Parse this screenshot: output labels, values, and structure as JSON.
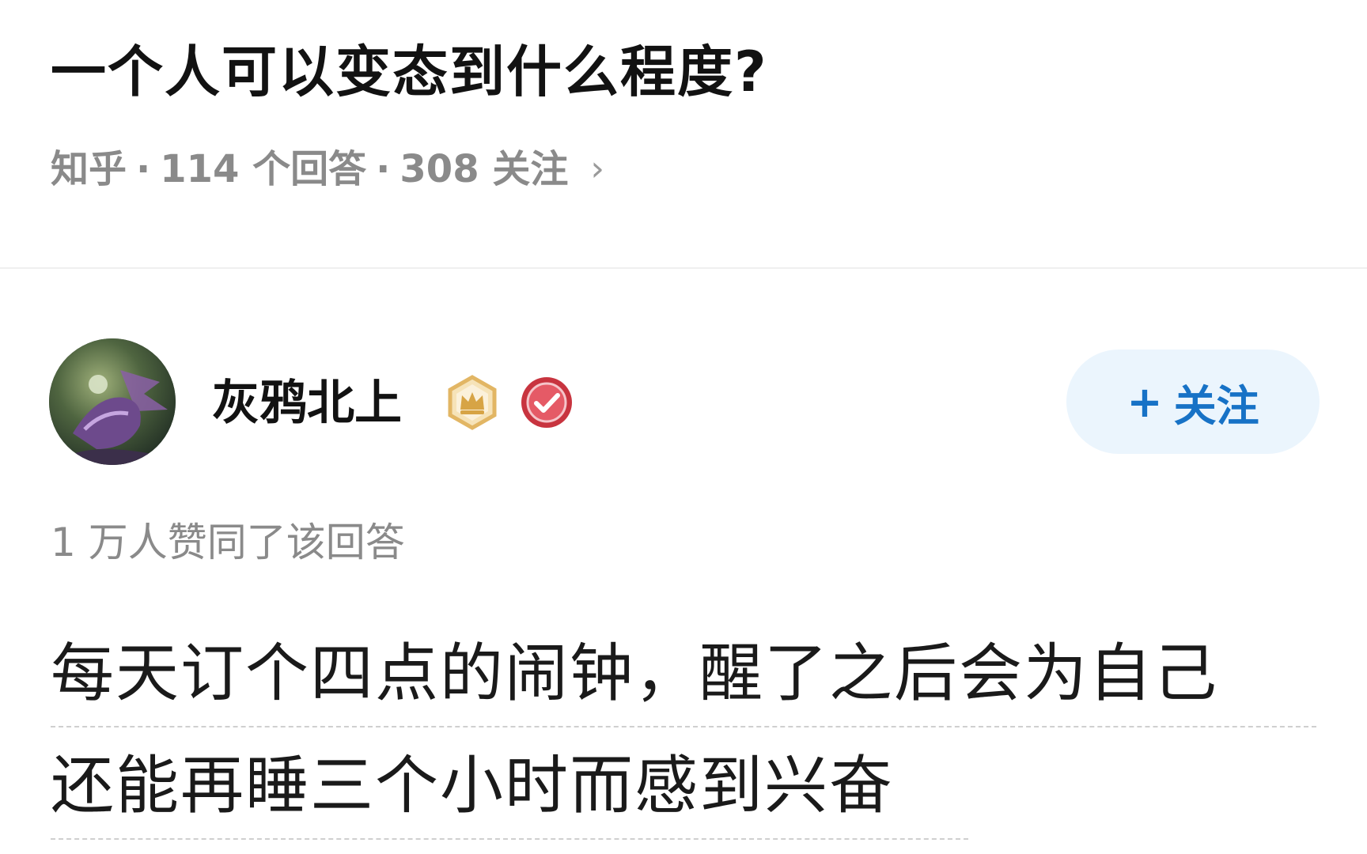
{
  "question": {
    "title": "一个人可以变态到什么程度?",
    "source": "知乎",
    "separator": "·",
    "answers": "114 个回答",
    "followers": "308 关注",
    "chevron": "›"
  },
  "author": {
    "name": "灰鸦北上",
    "badges": [
      "crown-badge-icon",
      "verified-badge-icon"
    ],
    "follow_plus": "+",
    "follow_label": "关注"
  },
  "answer": {
    "votes": "1 万人赞同了该回答",
    "lines": [
      "每天订个四点的闹钟，醒了之后会为自己",
      "还能再睡三个小时而感到兴奋"
    ]
  },
  "colors": {
    "title": "#121212",
    "meta": "#8a8a8a",
    "follow_bg": "#ebf5fd",
    "follow_text": "#1772c6",
    "divider": "#efefef"
  }
}
